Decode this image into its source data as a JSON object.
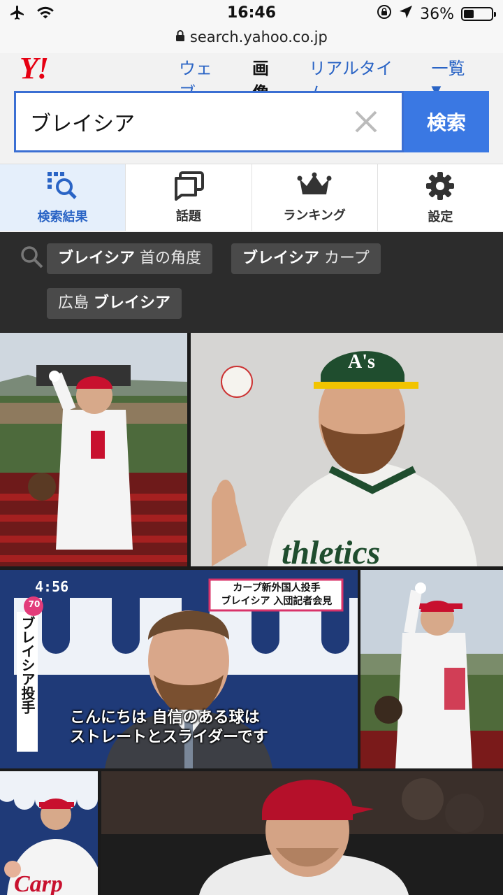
{
  "status_bar": {
    "time": "16:46",
    "battery": "36%",
    "battery_level": 0.36
  },
  "url_bar": {
    "url": "search.yahoo.co.jp"
  },
  "header": {
    "logo": "Y!",
    "nav": [
      {
        "label": "ウェブ"
      },
      {
        "label": "画像"
      },
      {
        "label": "リアルタイム"
      },
      {
        "label": "一覧"
      }
    ]
  },
  "search": {
    "query": "ブレイシア",
    "button": "検索"
  },
  "tabs": [
    {
      "label": "検索結果",
      "icon": "search-results-icon"
    },
    {
      "label": "話題",
      "icon": "chat-icon"
    },
    {
      "label": "ランキング",
      "icon": "crown-icon"
    },
    {
      "label": "設定",
      "icon": "gear-icon"
    }
  ],
  "related": [
    {
      "bold": "ブレイシア",
      "rest": " 首の角度"
    },
    {
      "bold": "ブレイシア",
      "rest": " カープ"
    },
    {
      "pre": "広島 ",
      "bold": "ブレイシア"
    }
  ],
  "images": [
    {
      "name": "image-result-1"
    },
    {
      "name": "image-result-2"
    },
    {
      "name": "image-result-3",
      "tv_time": "4:56",
      "tv_number": "70",
      "caption_box_line1": "カープ新外国人投手",
      "caption_box_line2": "ブレイシア 入団記者会見",
      "vertical_name": "ブレイシア投手",
      "subtitle_line1": "こんにちは 自信のある球は",
      "subtitle_line2": "ストレートとスライダーです"
    },
    {
      "name": "image-result-4"
    },
    {
      "name": "image-result-5"
    },
    {
      "name": "image-result-6"
    }
  ],
  "colors": {
    "accent": "#3a78e3",
    "link": "#2a64c5",
    "logo": "#e60012"
  }
}
